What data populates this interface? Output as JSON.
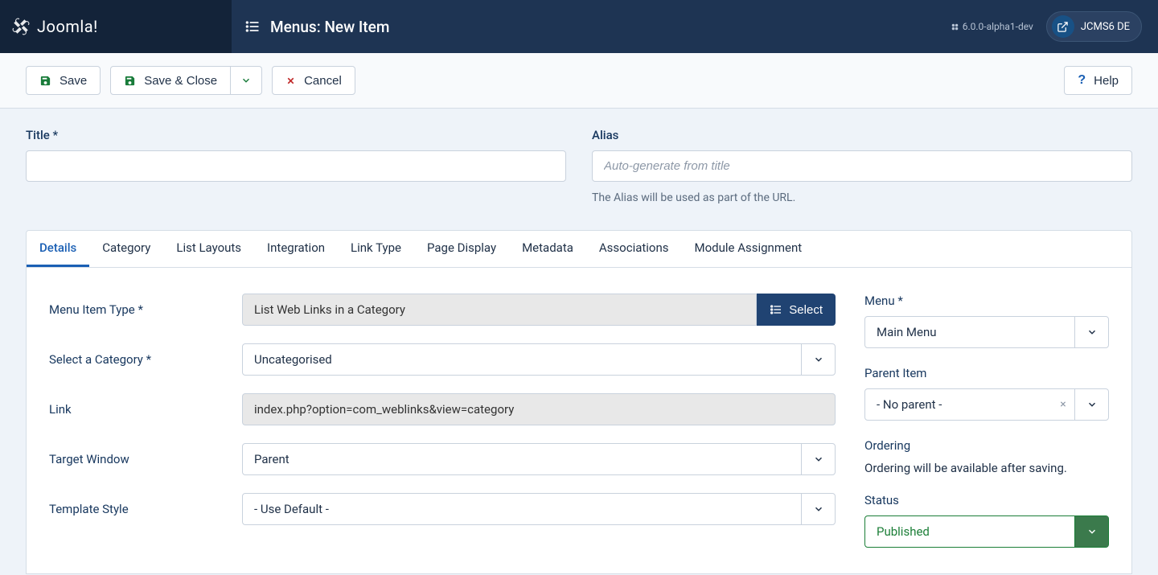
{
  "brand": "Joomla!",
  "page_title": "Menus: New Item",
  "version": "6.0.0-alpha1-dev",
  "site_badge": "JCMS6 DE",
  "toolbar": {
    "save": "Save",
    "save_close": "Save & Close",
    "cancel": "Cancel",
    "help": "Help"
  },
  "fields": {
    "title_label": "Title *",
    "title_value": "",
    "alias_label": "Alias",
    "alias_placeholder": "Auto-generate from title",
    "alias_help": "The Alias will be used as part of the URL."
  },
  "tabs": [
    "Details",
    "Category",
    "List Layouts",
    "Integration",
    "Link Type",
    "Page Display",
    "Metadata",
    "Associations",
    "Module Assignment"
  ],
  "details": {
    "menu_item_type_label": "Menu Item Type *",
    "menu_item_type_value": "List Web Links in a Category",
    "select_btn": "Select",
    "category_label": "Select a Category *",
    "category_value": "Uncategorised",
    "link_label": "Link",
    "link_value": "index.php?option=com_weblinks&view=category",
    "target_label": "Target Window",
    "target_value": "Parent",
    "template_label": "Template Style",
    "template_value": "- Use Default -"
  },
  "side": {
    "menu_label": "Menu *",
    "menu_value": "Main Menu",
    "parent_label": "Parent Item",
    "parent_value": "- No parent -",
    "ordering_label": "Ordering",
    "ordering_text": "Ordering will be available after saving.",
    "status_label": "Status",
    "status_value": "Published"
  }
}
